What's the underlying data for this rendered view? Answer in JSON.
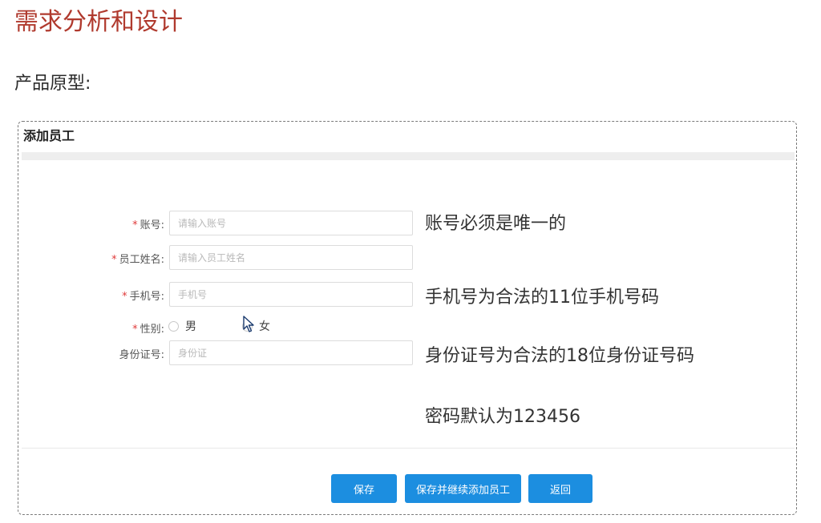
{
  "doc": {
    "title": "需求分析和设计",
    "subtitle": "产品原型:"
  },
  "form": {
    "header": "添加员工",
    "required_mark": "*",
    "fields": {
      "account": {
        "label": "账号:",
        "placeholder": "请输入账号",
        "required": true
      },
      "name": {
        "label": "员工姓名:",
        "placeholder": "请输入员工姓名",
        "required": true
      },
      "phone": {
        "label": "手机号:",
        "placeholder": "手机号",
        "required": true
      },
      "gender": {
        "label": "性别:",
        "required": true,
        "options": [
          "男",
          "女"
        ]
      },
      "id_number": {
        "label": "身份证号:",
        "placeholder": "身份证",
        "required": false
      }
    },
    "buttons": {
      "save": "保存",
      "save_continue": "保存并继续添加员工",
      "back": "返回"
    }
  },
  "notes": {
    "account": "账号必须是唯一的",
    "phone": "手机号为合法的11位手机号码",
    "id_number": "身份证号为合法的18位身份证号码",
    "password": "密码默认为123456"
  },
  "colors": {
    "title": "#b03a2e",
    "required": "#e03a3a",
    "button": "#1c8ee0"
  }
}
